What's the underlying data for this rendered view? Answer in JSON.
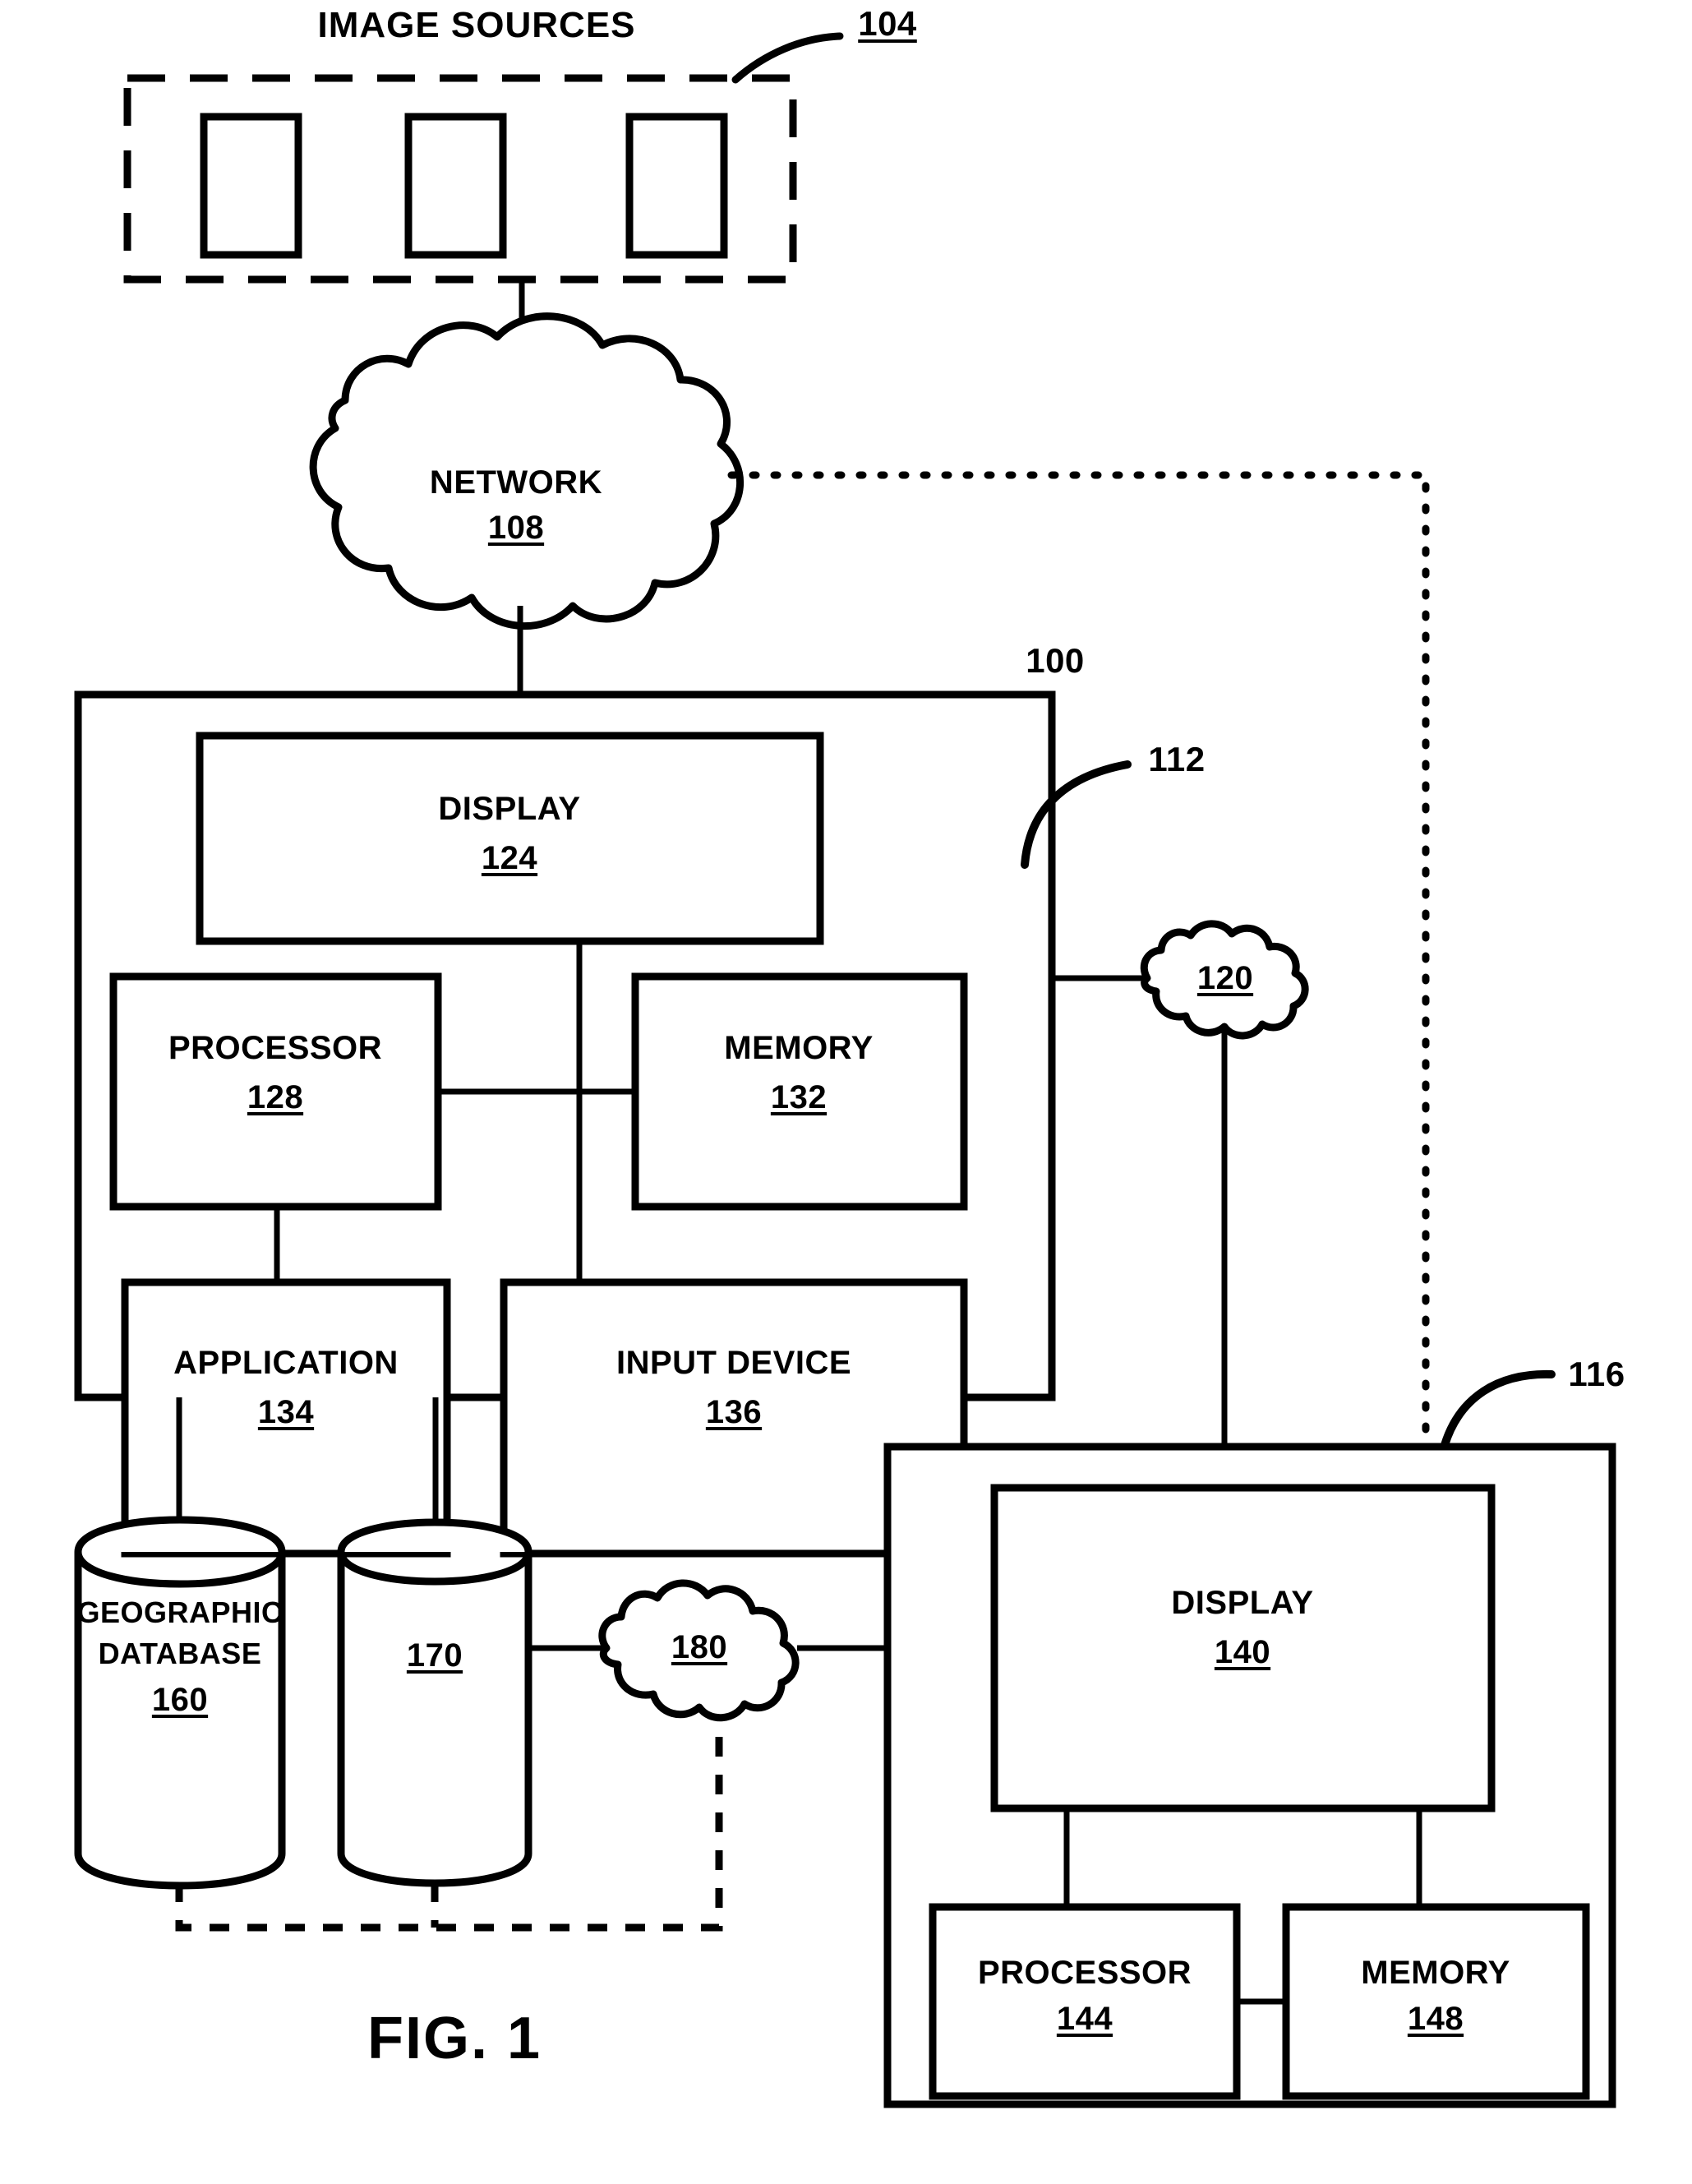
{
  "figure": {
    "caption": "FIG. 1",
    "system_ref": "100"
  },
  "image_sources": {
    "title": "IMAGE SOURCES",
    "ref": "104",
    "source_count": 3
  },
  "network": {
    "label": "NETWORK",
    "ref": "108"
  },
  "client_system": {
    "ref": "112",
    "blocks": [
      {
        "label": "DISPLAY",
        "ref": "124"
      },
      {
        "label": "PROCESSOR",
        "ref": "128"
      },
      {
        "label": "MEMORY",
        "ref": "132"
      },
      {
        "label": "APPLICATION",
        "ref": "134"
      },
      {
        "label": "INPUT DEVICE",
        "ref": "136"
      }
    ]
  },
  "link_cloud_120": {
    "ref": "120"
  },
  "link_cloud_180": {
    "ref": "180"
  },
  "databases": [
    {
      "line1": "GEOGRAPHIC",
      "line2": "DATABASE",
      "ref": "160"
    },
    {
      "line1": "",
      "line2": "",
      "ref": "170"
    }
  ],
  "device_system": {
    "ref": "116",
    "blocks": [
      {
        "label": "DISPLAY",
        "ref": "140"
      },
      {
        "label": "PROCESSOR",
        "ref": "144"
      },
      {
        "label": "MEMORY",
        "ref": "148"
      }
    ]
  },
  "colors": {
    "stroke": "#000000",
    "background": "#ffffff"
  }
}
